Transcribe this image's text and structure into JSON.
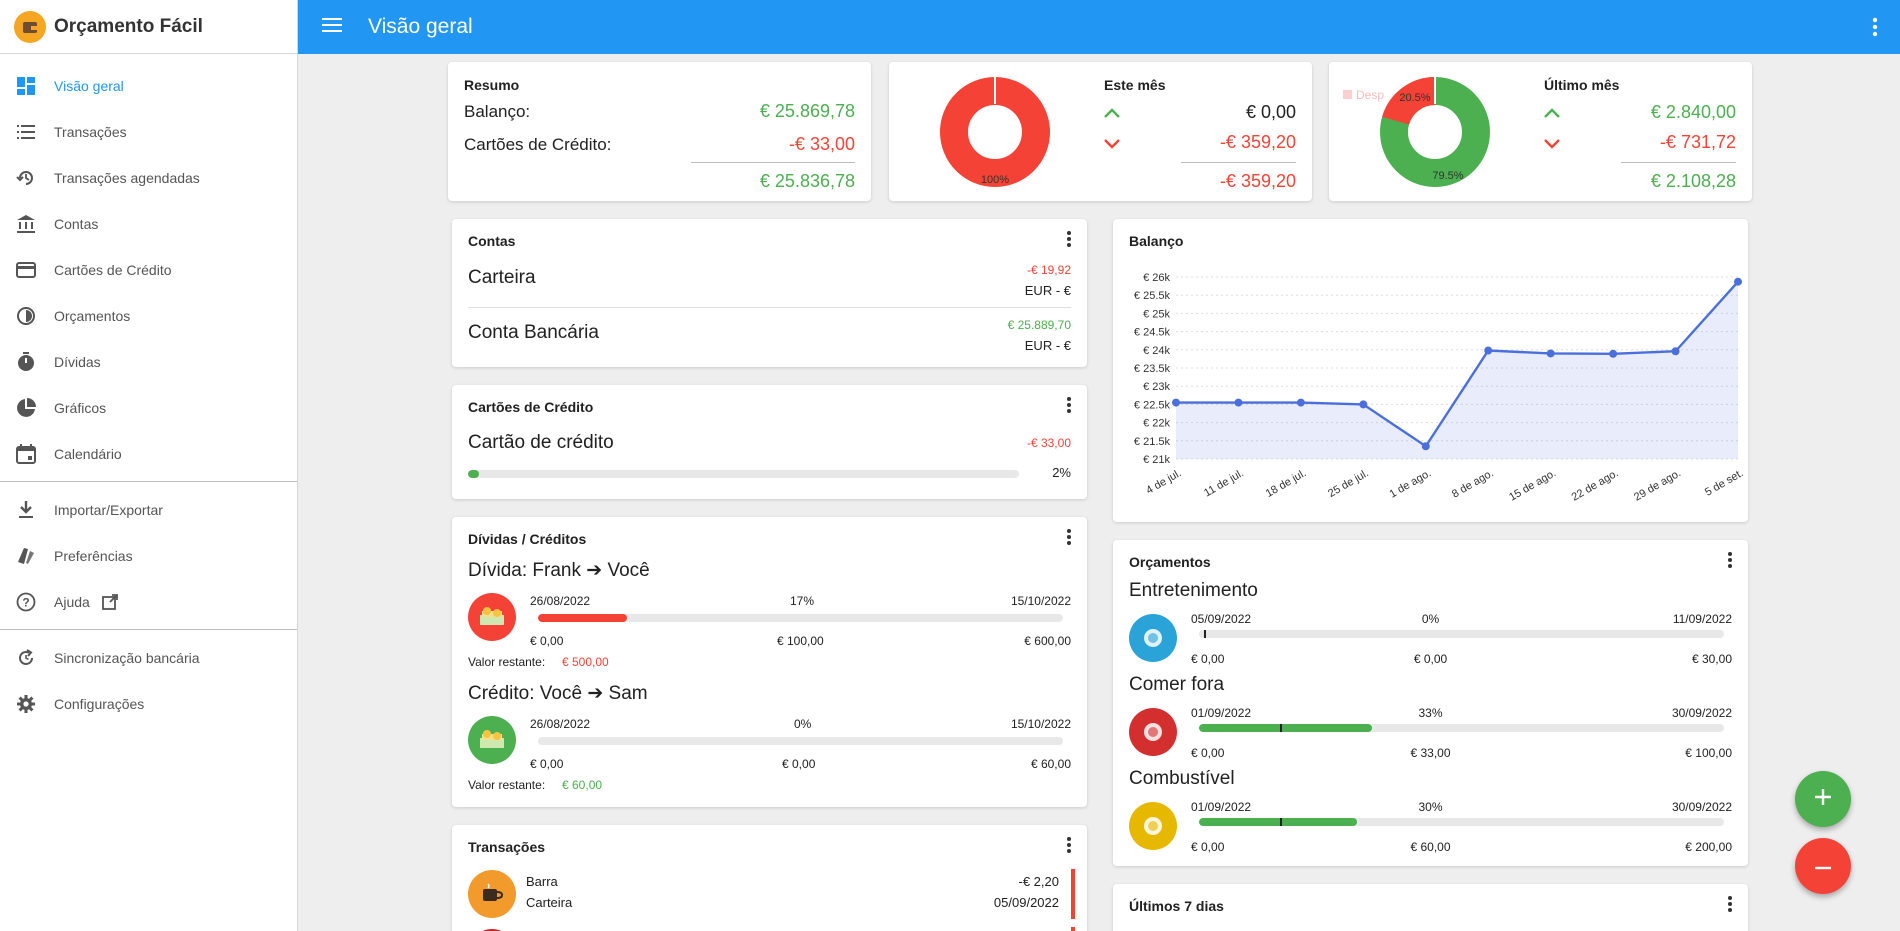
{
  "app": {
    "title": "Orçamento Fácil"
  },
  "topbar": {
    "title": "Visão geral"
  },
  "sidebar": {
    "items": [
      {
        "label": "Visão geral"
      },
      {
        "label": "Transações"
      },
      {
        "label": "Transações agendadas"
      },
      {
        "label": "Contas"
      },
      {
        "label": "Cartões de Crédito"
      },
      {
        "label": "Orçamentos"
      },
      {
        "label": "Dívidas"
      },
      {
        "label": "Gráficos"
      },
      {
        "label": "Calendário"
      },
      {
        "label": "Importar/Exportar"
      },
      {
        "label": "Preferências"
      },
      {
        "label": "Ajuda"
      },
      {
        "label": "Sincronização bancária"
      },
      {
        "label": "Configurações"
      }
    ]
  },
  "resumo": {
    "title": "Resumo",
    "balanco_label": "Balanço:",
    "balanco_value": "€ 25.869,78",
    "cartoes_label": "Cartões de Crédito:",
    "cartoes_value": "-€ 33,00",
    "total": "€ 25.836,78"
  },
  "este_mes": {
    "title": "Este mês",
    "income": "€ 0,00",
    "expense": "-€ 359,20",
    "total": "-€ 359,20",
    "pie_label": "100%",
    "expense_fraction": 1.0
  },
  "ultimo_mes": {
    "title": "Último mês",
    "income": "€ 2.840,00",
    "expense": "-€ 731,72",
    "total": "€ 2.108,28",
    "pie_label_expense": "20.5%",
    "pie_label_income": "79.5%",
    "legend_faded": "Desp",
    "expense_fraction": 0.205
  },
  "contas": {
    "title": "Contas",
    "items": [
      {
        "name": "Carteira",
        "value": "-€ 19,92",
        "currency": "EUR - €"
      },
      {
        "name": "Conta Bancária",
        "value": "€ 25.889,70",
        "currency": "EUR - €"
      }
    ]
  },
  "cartoes": {
    "title": "Cartões de Crédito",
    "name": "Cartão de crédito",
    "value": "-€ 33,00",
    "percent": "2%",
    "fraction": 0.02
  },
  "dividas": {
    "title": "Dívidas / Créditos",
    "items": [
      {
        "title": "Dívida: Frank ➔ Você",
        "start": "26/08/2022",
        "percent": "17%",
        "end": "15/10/2022",
        "min": "€ 0,00",
        "mid": "€ 100,00",
        "max": "€ 600,00",
        "remaining_label": "Valor restante:",
        "remaining": "€ 500,00",
        "fraction": 0.17
      },
      {
        "title": "Crédito: Você ➔ Sam",
        "start": "26/08/2022",
        "percent": "0%",
        "end": "15/10/2022",
        "min": "€ 0,00",
        "mid": "€ 0,00",
        "max": "€ 60,00",
        "remaining_label": "Valor restante:",
        "remaining": "€ 60,00",
        "fraction": 0.0
      }
    ]
  },
  "transacoes": {
    "title": "Transações",
    "items": [
      {
        "name": "Barra",
        "account": "Carteira",
        "amount": "-€ 2,20",
        "date": "05/09/2022"
      }
    ]
  },
  "balanco_chart": {
    "title": "Balanço"
  },
  "chart_data": {
    "type": "line",
    "title": "Balanço",
    "x": [
      "4 de jul.",
      "11 de jul.",
      "18 de jul.",
      "25 de jul.",
      "1 de ago.",
      "8 de ago.",
      "15 de ago.",
      "22 de ago.",
      "29 de ago.",
      "5 de set."
    ],
    "values": [
      22550,
      22550,
      22550,
      22500,
      21350,
      23980,
      23900,
      23890,
      23960,
      25870
    ],
    "y_ticks": [
      "€ 21k",
      "€ 21.5k",
      "€ 22k",
      "€ 22.5k",
      "€ 23k",
      "€ 23.5k",
      "€ 24k",
      "€ 24.5k",
      "€ 25k",
      "€ 25.5k",
      "€ 26k"
    ],
    "ylim": [
      21000,
      26000
    ],
    "grid": true,
    "color": "#4a6fdc"
  },
  "orcamentos": {
    "title": "Orçamentos",
    "items": [
      {
        "name": "Entretenimento",
        "start": "05/09/2022",
        "percent": "0%",
        "end": "11/09/2022",
        "min": "€ 0,00",
        "mid": "€ 0,00",
        "max": "€ 30,00",
        "fraction": 0.0,
        "marker": 0.01,
        "icon": "party-hat-icon",
        "color": "#29a3d8"
      },
      {
        "name": "Comer fora",
        "start": "01/09/2022",
        "percent": "33%",
        "end": "30/09/2022",
        "min": "€ 0,00",
        "mid": "€ 33,00",
        "max": "€ 100,00",
        "fraction": 0.33,
        "marker": 0.155,
        "icon": "plate-icon",
        "color": "#d32f2f"
      },
      {
        "name": "Combustível",
        "start": "01/09/2022",
        "percent": "30%",
        "end": "30/09/2022",
        "min": "€ 0,00",
        "mid": "€ 60,00",
        "max": "€ 200,00",
        "fraction": 0.3,
        "marker": 0.155,
        "icon": "fuel-pump-icon",
        "color": "#e6b800"
      }
    ]
  },
  "ultimos7": {
    "title": "Últimos 7 dias"
  },
  "colors": {
    "primary": "#2196f3",
    "positive": "#4caf50",
    "negative": "#f44336"
  }
}
